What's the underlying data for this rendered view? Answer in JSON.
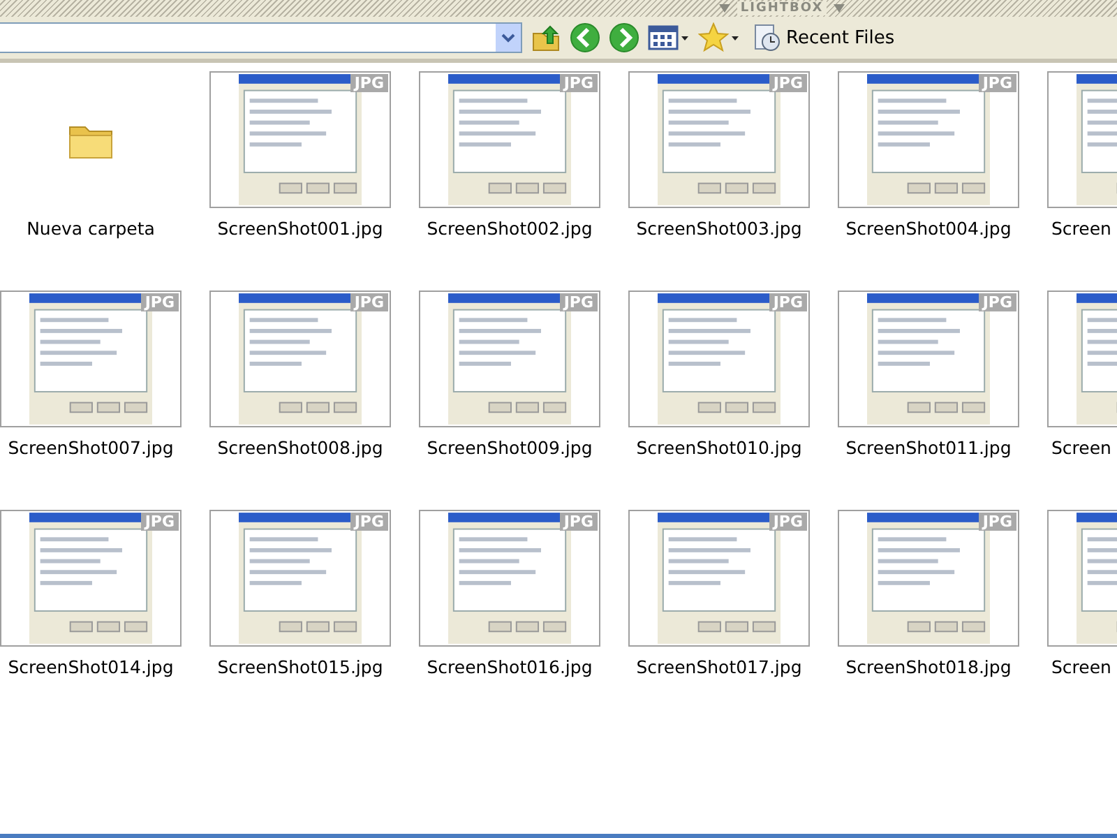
{
  "panel": {
    "title": "LIGHTBOX"
  },
  "toolbar": {
    "recent_files": "Recent Files"
  },
  "items": [
    {
      "name": "Nueva carpeta",
      "kind": "folder"
    },
    {
      "name": "ScreenShot001.jpg",
      "kind": "image",
      "badge": "JPG"
    },
    {
      "name": "ScreenShot002.jpg",
      "kind": "image",
      "badge": "JPG"
    },
    {
      "name": "ScreenShot003.jpg",
      "kind": "image",
      "badge": "JPG"
    },
    {
      "name": "ScreenShot004.jpg",
      "kind": "image",
      "badge": "JPG"
    },
    {
      "name": "Screen",
      "kind": "image"
    },
    {
      "name": "ScreenShot007.jpg",
      "kind": "image",
      "badge": "JPG"
    },
    {
      "name": "ScreenShot008.jpg",
      "kind": "image",
      "badge": "JPG"
    },
    {
      "name": "ScreenShot009.jpg",
      "kind": "image",
      "badge": "JPG"
    },
    {
      "name": "ScreenShot010.jpg",
      "kind": "image",
      "badge": "JPG"
    },
    {
      "name": "ScreenShot011.jpg",
      "kind": "image",
      "badge": "JPG"
    },
    {
      "name": "Screen",
      "kind": "image"
    },
    {
      "name": "ScreenShot014.jpg",
      "kind": "image",
      "badge": "JPG"
    },
    {
      "name": "ScreenShot015.jpg",
      "kind": "image",
      "badge": "JPG"
    },
    {
      "name": "ScreenShot016.jpg",
      "kind": "image",
      "badge": "JPG"
    },
    {
      "name": "ScreenShot017.jpg",
      "kind": "image",
      "badge": "JPG"
    },
    {
      "name": "ScreenShot018.jpg",
      "kind": "image",
      "badge": "JPG"
    },
    {
      "name": "Screen",
      "kind": "image"
    }
  ]
}
